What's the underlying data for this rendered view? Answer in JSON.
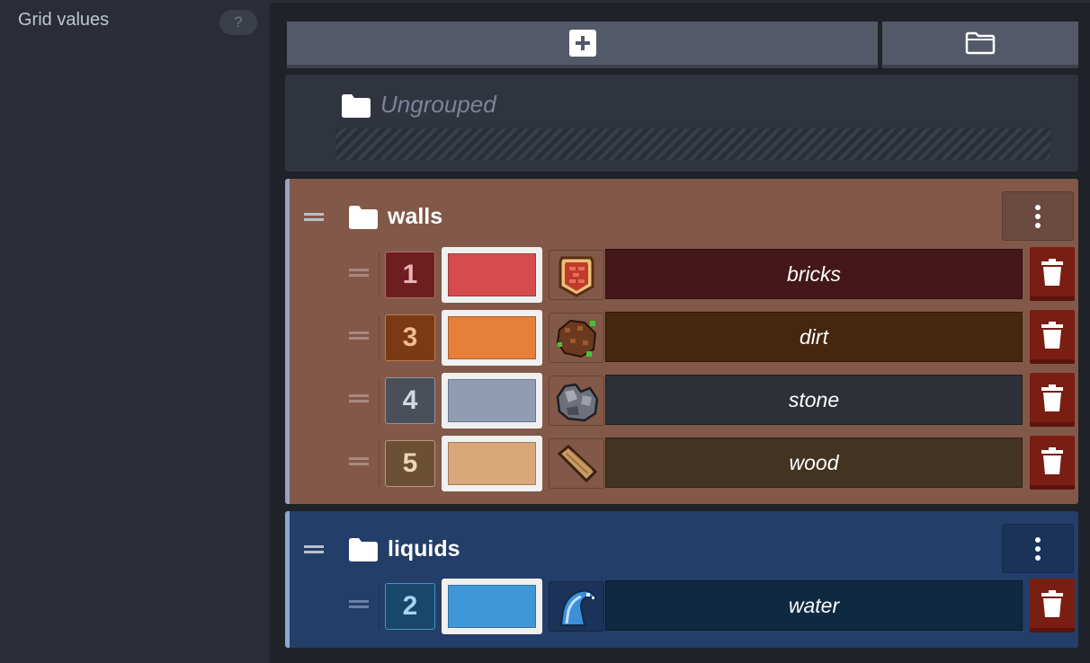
{
  "left": {
    "title": "Grid values",
    "help": "?"
  },
  "toolbar": {
    "add_icon": "plus-icon",
    "folder_icon": "folder-icon"
  },
  "ungrouped": {
    "label": "Ungrouped"
  },
  "groups": [
    {
      "name": "walls",
      "color": "#825849",
      "items": [
        {
          "id": "1",
          "color": "#d64c4c",
          "num_bg": "#6e1e1e",
          "num_fg": "#e9b3b3",
          "num_border": "#b06a6a",
          "name_bg": "#44171a",
          "icon": "bricks-icon",
          "name": "bricks"
        },
        {
          "id": "3",
          "color": "#e67f39",
          "num_bg": "#7a3b14",
          "num_fg": "#f1bb8e",
          "num_border": "#c07a4c",
          "name_bg": "#45260f",
          "icon": "dirt-icon",
          "name": "dirt"
        },
        {
          "id": "4",
          "color": "#8f9cb3",
          "num_bg": "#4a4f5a",
          "num_fg": "#d2d7e0",
          "num_border": "#8e96a6",
          "name_bg": "#2d3037",
          "icon": "stone-icon",
          "name": "stone"
        },
        {
          "id": "5",
          "color": "#d8a77a",
          "num_bg": "#6c5035",
          "num_fg": "#ecd5b8",
          "num_border": "#b8967a",
          "name_bg": "#433321",
          "icon": "wood-icon",
          "name": "wood"
        }
      ]
    },
    {
      "name": "liquids",
      "color": "#233e68",
      "items": [
        {
          "id": "2",
          "color": "#3f97d8",
          "num_bg": "#17476a",
          "num_fg": "#a5d3f3",
          "num_border": "#4e8fbf",
          "name_bg": "#0f2a40",
          "icon": "water-icon",
          "name": "water"
        }
      ]
    }
  ]
}
